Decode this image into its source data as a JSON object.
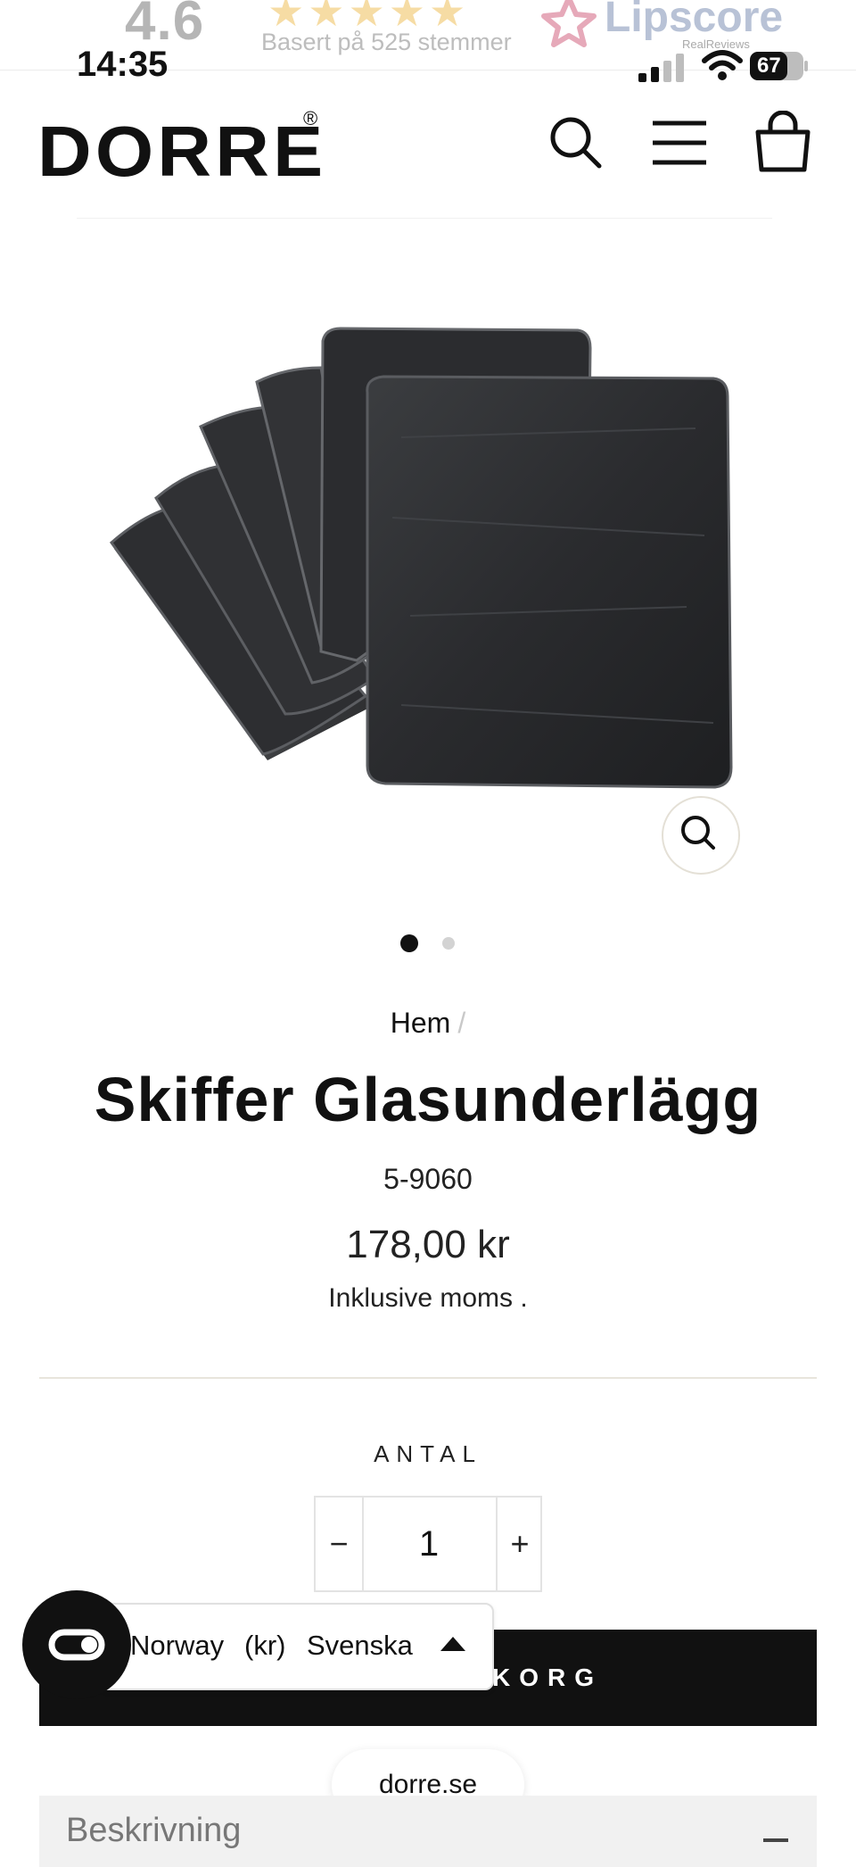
{
  "lipscore": {
    "score": "4.6",
    "stars": "★★★★★",
    "subtitle": "Basert på 525 stemmer",
    "brand": "Lipscore",
    "tagline": "RealReviews"
  },
  "status_bar": {
    "time": "14:35",
    "battery": "67"
  },
  "header": {
    "logo": "DORRE",
    "logo_mark": "®"
  },
  "product": {
    "image_alt": "Skiffer Glasunderlägg",
    "gallery_count": 2,
    "gallery_active": 1,
    "breadcrumb": "Hem",
    "breadcrumb_sep": "/",
    "title": "Skiffer Glasunderlägg",
    "sku": "5-9060",
    "price": "178,00 kr",
    "tax_note": "Inklusive moms ."
  },
  "quantity": {
    "label": "ANTAL",
    "minus": "−",
    "value": "1",
    "plus": "+"
  },
  "add_to_cart": {
    "label_visible": "KORG"
  },
  "locale": {
    "country": "Norway",
    "currency": "(kr)",
    "language": "Svenska"
  },
  "browser": {
    "url": "dorre.se"
  },
  "accordion": {
    "description_label": "Beskrivning"
  }
}
